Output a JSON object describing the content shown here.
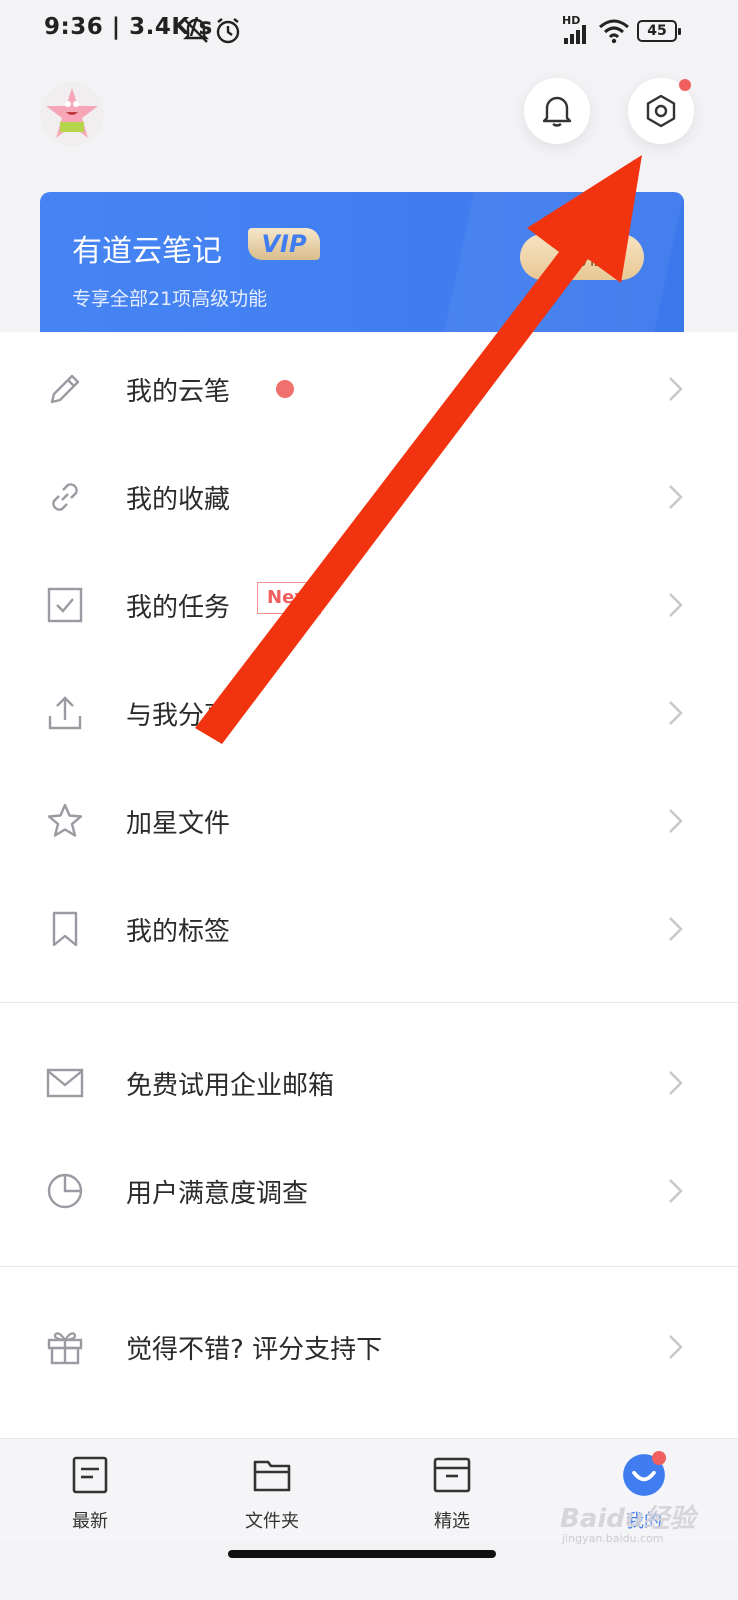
{
  "status_bar": {
    "time_speed": "9:36 | 3.4K/s",
    "battery": "45",
    "network_label": "HD"
  },
  "header": {
    "avatar_icon": "patrick-star-avatar",
    "notification_icon": "bell-icon",
    "settings_icon": "settings-hexagon-icon"
  },
  "vip_card": {
    "title": "有道云笔记",
    "badge": "VIP",
    "subtitle": "专享全部21项高级功能",
    "button": "试用"
  },
  "menu": {
    "group1": [
      {
        "label": "我的云笔",
        "icon": "pen-icon",
        "has_dot": true
      },
      {
        "label": "我的收藏",
        "icon": "link-icon"
      },
      {
        "label": "我的任务",
        "icon": "checkbox-icon",
        "tag": "New"
      },
      {
        "label": "与我分享",
        "icon": "share-upload-icon"
      },
      {
        "label": "加星文件",
        "icon": "star-icon"
      },
      {
        "label": "我的标签",
        "icon": "bookmark-icon"
      }
    ],
    "group2": [
      {
        "label": "免费试用企业邮箱",
        "icon": "mail-icon"
      },
      {
        "label": "用户满意度调查",
        "icon": "pie-chart-icon"
      }
    ],
    "group3": [
      {
        "label": "觉得不错? 评分支持下",
        "icon": "gift-icon"
      }
    ]
  },
  "bottom_nav": [
    {
      "label": "最新",
      "icon": "document-icon"
    },
    {
      "label": "文件夹",
      "icon": "folder-icon"
    },
    {
      "label": "精选",
      "icon": "archive-icon"
    },
    {
      "label": "我的",
      "icon": "smile-avatar-icon",
      "active": true
    }
  ],
  "watermark": {
    "text": "Baidu经验",
    "sub": "jingyan.baidu.com"
  },
  "colors": {
    "brand_blue": "#3f7df0",
    "red_dot": "#f0605e",
    "arrow_red": "#f2330f"
  }
}
